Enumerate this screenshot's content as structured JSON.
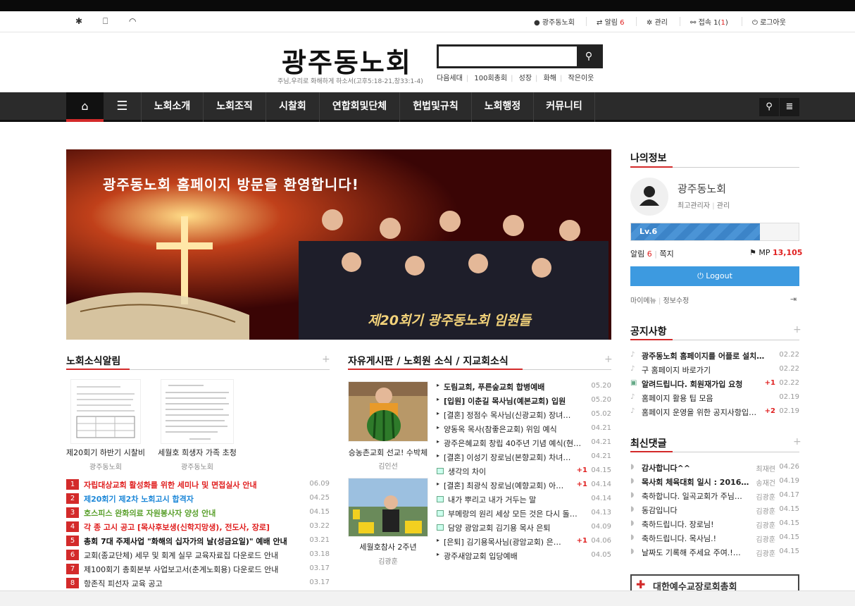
{
  "util": {
    "user": "광주동노회",
    "alarm_label": "알림",
    "alarm_count": "6",
    "admin": "관리",
    "online_label": "접속",
    "online_count": "1",
    "online_count2": "1",
    "logout": "로그아웃"
  },
  "header": {
    "logo": "광주동노회",
    "slogan": "주님,우리로 화해하게 하소서(고후5:18-21,창33:1-4)",
    "search_placeholder": "",
    "quick_links": [
      "다음세대",
      "100회총회",
      "성장",
      "화해",
      "작은이웃"
    ]
  },
  "nav": {
    "items": [
      "노회소개",
      "노회조직",
      "시찰회",
      "연합회및단체",
      "헌법및규칙",
      "노회행정",
      "커뮤니티"
    ]
  },
  "banner": {
    "headline": "광주동노회 홈페이지 방문을 환영합니다!",
    "caption": "제20회기 광주동노회 임원들"
  },
  "news": {
    "title": "노회소식알림",
    "plus": "+",
    "gallery": [
      {
        "caption": "제20회기 하반기 시찰비",
        "author": "광주동노회"
      },
      {
        "caption": "세월호 희생자 가족 초청",
        "author": "광주동노회"
      }
    ],
    "items": [
      {
        "num": "1",
        "text": "자립대상교회 활성화를 위한 세미나 및 면접실사 안내",
        "date": "06.09",
        "color": "#e02020"
      },
      {
        "num": "2",
        "text": "제20회기 제2차 노회고시 합격자",
        "date": "04.25",
        "color": "#1e88d8"
      },
      {
        "num": "3",
        "text": "호스피스 완화의료 자원봉사자 양성 안내",
        "date": "04.15",
        "color": "#5aa02c"
      },
      {
        "num": "4",
        "text": "각 종 고시 공고 [목사후보생(신학지망생), 전도사, 장로]",
        "date": "03.22",
        "color": "#e02020"
      },
      {
        "num": "5",
        "text": "총회 7대 주제사업 \"화해의 십자가의 날(성금요일)\" 예배 안내",
        "date": "03.21",
        "color": "#111"
      },
      {
        "num": "6",
        "text": "교회(종교단체) 세무 및 회계 실무 교육자료집 다운로드 안내",
        "date": "03.18",
        "color": "#222"
      },
      {
        "num": "7",
        "text": "제100회기 총회본부 사업보고서(춘계노회용) 다운로드 안내",
        "date": "03.17",
        "color": "#222"
      },
      {
        "num": "8",
        "text": "항존직 피선자 교육 공고",
        "date": "03.17",
        "color": "#222"
      }
    ]
  },
  "board": {
    "title": "자유게시판 / 노회원 소식 / 지교회소식",
    "plus": "+",
    "thumbs": [
      {
        "caption": "승농촌교회 선교! 수박체",
        "author": "김인선"
      },
      {
        "caption": "세월호참사 2주년",
        "author": "김광훈"
      }
    ],
    "items": [
      {
        "text": "도림교회, 푸른숲교회 합병예배",
        "date": "05.20",
        "plus": "",
        "bold": true,
        "img": false
      },
      {
        "text": "[입원] 이춘길 목사님(예본교회) 입원",
        "date": "05.20",
        "plus": "",
        "bold": true,
        "img": false
      },
      {
        "text": "[결혼] 정점수 목사님(신광교회) 장녀…",
        "date": "05.02",
        "plus": "",
        "bold": false,
        "img": false
      },
      {
        "text": "양동옥 목사(참좋은교회) 위임 예식",
        "date": "04.21",
        "plus": "",
        "bold": false,
        "img": false
      },
      {
        "text": "광주은혜교회 창립 40주년 기념 예식(현…",
        "date": "04.21",
        "plus": "",
        "bold": false,
        "img": false
      },
      {
        "text": "[결혼] 이성기 장로님(본향교회) 차녀…",
        "date": "04.21",
        "plus": "",
        "bold": false,
        "img": false
      },
      {
        "text": "생각의 차이",
        "date": "04.15",
        "plus": "+1",
        "bold": false,
        "img": true
      },
      {
        "text": "[결혼] 최광식 장로님(예향교회) 아…",
        "date": "04.14",
        "plus": "+1",
        "bold": false,
        "img": false
      },
      {
        "text": "내가 뿌리고 내가 거두는 말",
        "date": "04.14",
        "plus": "",
        "bold": false,
        "img": true
      },
      {
        "text": "부메랑의 원리 세상 모든 것은 다시 돌…",
        "date": "04.13",
        "plus": "",
        "bold": false,
        "img": true
      },
      {
        "text": "담양 광암교회 김기용 목사 은퇴",
        "date": "04.09",
        "plus": "",
        "bold": false,
        "img": true
      },
      {
        "text": "[은퇴] 김기용목사님(광암교회) 은…",
        "date": "04.06",
        "plus": "+1",
        "bold": false,
        "img": false
      },
      {
        "text": "광주새암교회 입당예배",
        "date": "04.05",
        "plus": "",
        "bold": false,
        "img": false
      }
    ]
  },
  "myinfo": {
    "title": "나의정보",
    "name": "광주동노회",
    "role": "최고관리자",
    "admin": "관리",
    "level": "Lv.6",
    "level_progress": 0.77,
    "alarm_label": "알림",
    "alarm_count": "6",
    "memo_label": "쪽지",
    "mp_label": "MP",
    "mp_value": "13,105",
    "logout": "Logout",
    "mymenu": "마이메뉴",
    "edit": "정보수정"
  },
  "notice": {
    "title": "공지사항",
    "plus": "+",
    "items": [
      {
        "text": "광주동노회 홈페이지를 어플로 설치…",
        "date": "02.22",
        "plus": "",
        "bold": true,
        "img": false
      },
      {
        "text": "구 홈페이지 바로가기",
        "date": "02.22",
        "plus": "",
        "bold": false,
        "img": false
      },
      {
        "text": "알려드립니다. 회원재가입 요청",
        "date": "02.22",
        "plus": "+1",
        "bold": true,
        "img": true
      },
      {
        "text": "홈페이지 활용 팁 모음",
        "date": "02.19",
        "plus": "",
        "bold": false,
        "img": false
      },
      {
        "text": "홈페이지 운영을 위한 공지사항입…",
        "date": "02.19",
        "plus": "+2",
        "bold": false,
        "img": false
      }
    ]
  },
  "comments": {
    "title": "최신댓글",
    "plus": "+",
    "items": [
      {
        "text": "감사합니다^^",
        "author": "최재련",
        "date": "04.26",
        "bold": true
      },
      {
        "text": "목사회 체육대회 일시 : 2016…",
        "author": "송재건",
        "date": "04.19",
        "bold": true
      },
      {
        "text": "축하합니다. 일곡교회가 주님…",
        "author": "김광훈",
        "date": "04.17",
        "bold": false
      },
      {
        "text": "동감입니다",
        "author": "김광훈",
        "date": "04.15",
        "bold": false
      },
      {
        "text": "축하드립니다. 장로님!",
        "author": "김광훈",
        "date": "04.15",
        "bold": false
      },
      {
        "text": "축하드립니다. 목사님.!",
        "author": "김광훈",
        "date": "04.15",
        "bold": false
      },
      {
        "text": "날짜도 기록해 주세요 주여.!…",
        "author": "김광훈",
        "date": "04.15",
        "bold": false
      }
    ]
  },
  "bottom_banner": {
    "text": "대한예수교장로회총회"
  }
}
